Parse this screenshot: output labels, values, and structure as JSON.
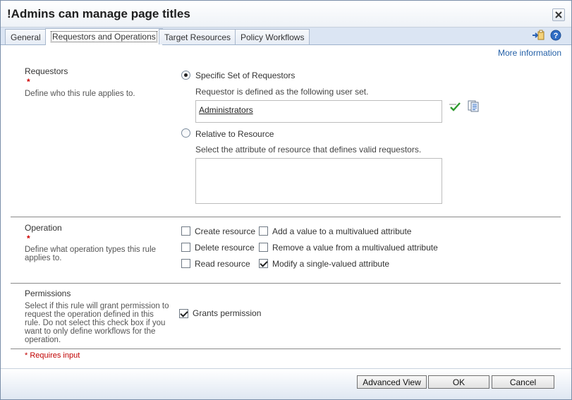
{
  "dialog": {
    "title": "!Admins can manage page titles"
  },
  "tabs": [
    {
      "label": "General"
    },
    {
      "label": "Requestors and Operations"
    },
    {
      "label": "Target Resources"
    },
    {
      "label": "Policy Workflows"
    }
  ],
  "toolbar": {
    "more_info": "More information"
  },
  "requestors": {
    "heading": "Requestors",
    "required_mark": "*",
    "description": "Define who this rule applies to.",
    "specific_label": "Specific Set of Requestors",
    "specific_hint": "Requestor is defined as the following user set.",
    "specific_value": "Administrators",
    "relative_label": "Relative to Resource",
    "relative_hint": "Select the attribute of resource that defines valid requestors.",
    "relative_value": ""
  },
  "operation": {
    "heading": "Operation",
    "required_mark": "*",
    "description": "Define what operation types this rule applies to.",
    "options": [
      {
        "label": "Create resource",
        "checked": false
      },
      {
        "label": "Add a value to a multivalued attribute",
        "checked": false
      },
      {
        "label": "Delete resource",
        "checked": false
      },
      {
        "label": "Remove a value from a multivalued attribute",
        "checked": false
      },
      {
        "label": "Read resource",
        "checked": false
      },
      {
        "label": "Modify a single-valued attribute",
        "checked": true
      }
    ]
  },
  "permissions": {
    "heading": "Permissions",
    "description": "Select if this rule will grant permission to request the operation defined in this rule. Do not select this check box if you want to only define workflows for the operation.",
    "grants_label": "Grants permission",
    "grants_checked": true
  },
  "requires_input_note": "* Requires input",
  "buttons": {
    "advanced": "Advanced View",
    "ok": "OK",
    "cancel": "Cancel"
  },
  "icons": {
    "close": "close-icon",
    "export": "export-icon",
    "help": "help-icon",
    "check_names": "check-names-icon",
    "browse": "browse-icon"
  },
  "colors": {
    "accent": "#2460a7",
    "required": "#d00000",
    "tab_bar": "#dbe5f3"
  }
}
